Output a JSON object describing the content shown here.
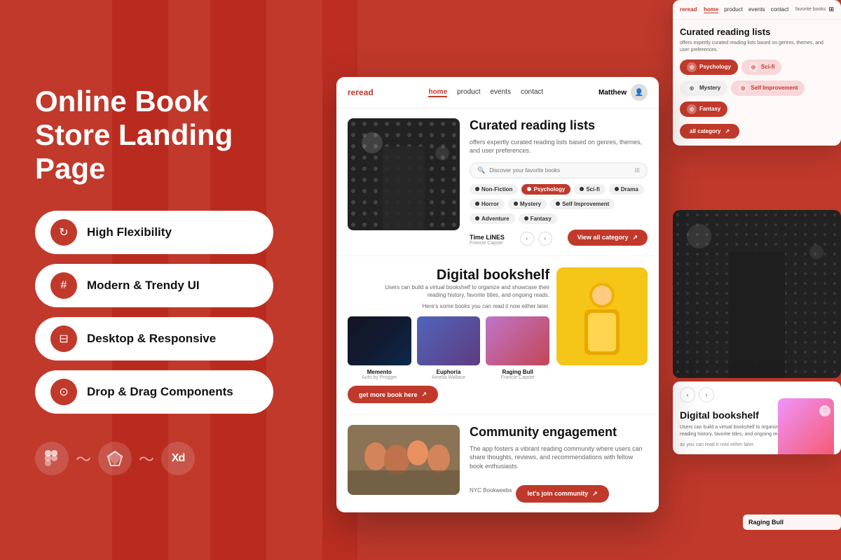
{
  "page": {
    "title": "Online Book Store Landing Page",
    "background_color": "#c0392b"
  },
  "left": {
    "title_line1": "Online Book",
    "title_line2": "Store Landing Page",
    "features": [
      {
        "id": "high-flexibility",
        "icon": "↻",
        "label": "High Flexibility"
      },
      {
        "id": "modern-trendy",
        "icon": "#",
        "label": "Modern & Trendy UI"
      },
      {
        "id": "desktop-responsive",
        "icon": "⊟",
        "label": "Desktop & Responsive"
      },
      {
        "id": "drop-drag",
        "icon": "⊙",
        "label": "Drop & Drag Components"
      }
    ],
    "tools": [
      {
        "id": "figma",
        "label": "Figma"
      },
      {
        "id": "sketch",
        "label": "Sketch"
      },
      {
        "id": "xd",
        "label": "Xd"
      }
    ]
  },
  "browser": {
    "logo": "reread",
    "nav_items": [
      {
        "id": "home",
        "label": "home",
        "active": true
      },
      {
        "id": "product",
        "label": "product",
        "active": false
      },
      {
        "id": "events",
        "label": "events",
        "active": false
      },
      {
        "id": "contact",
        "label": "contact",
        "active": false
      }
    ],
    "user_name": "Matthew",
    "sections": {
      "curated": {
        "title": "Curated reading lists",
        "description": "offers expertly curated reading lists based on genres, themes, and user preferences.",
        "search_placeholder": "Discover your favorite books",
        "tags": [
          {
            "id": "non-fiction",
            "label": "Non-Fiction",
            "active": false
          },
          {
            "id": "psychology",
            "label": "Psychology",
            "active": true
          },
          {
            "id": "sci-fi",
            "label": "Sci-fi",
            "active": false
          },
          {
            "id": "drama",
            "label": "Drama",
            "active": false
          },
          {
            "id": "horror",
            "label": "Horror",
            "active": false
          },
          {
            "id": "mystery",
            "label": "Mystery",
            "active": false
          },
          {
            "id": "self-improvement",
            "label": "Self Improvement",
            "active": false
          },
          {
            "id": "adventure",
            "label": "Adventure",
            "active": false
          },
          {
            "id": "fantasy",
            "label": "Fantasy",
            "active": false
          }
        ],
        "book_title": "Time LINES",
        "book_author": "Francie Capote",
        "view_all_label": "View all category"
      },
      "digital": {
        "title": "Digital bookshelf",
        "description": "Users can build a virtual bookshelf to organize and showcase their reading history, favorite titles, and ongoing reads.",
        "sub_desc": "Here's some books you can read it now either later.",
        "books": [
          {
            "id": "memento",
            "title": "Memento",
            "author": "Auto by Progger",
            "cover": "dark-blue"
          },
          {
            "id": "euphoria",
            "title": "Euphoria",
            "author": "Amelia Wallace",
            "cover": "purple"
          },
          {
            "id": "raging-bull",
            "title": "Raging Bull",
            "author": "Francie Capote",
            "cover": "pink"
          }
        ],
        "get_more_label": "get more book here"
      },
      "community": {
        "title": "Community engagement",
        "description": "The app fosters a vibrant reading community where users can share thoughts, reviews, and recommendations with fellow book enthusiasts.",
        "image_caption": "NYC Bookweebs",
        "join_label": "let's join community"
      }
    }
  },
  "right_panel": {
    "nav_items": [
      {
        "id": "home",
        "label": "home",
        "active": true
      },
      {
        "id": "product",
        "label": "product",
        "active": false
      },
      {
        "id": "events",
        "label": "events",
        "active": false
      },
      {
        "id": "contact",
        "label": "contact",
        "active": false
      }
    ],
    "favorite_books_label": "favorite books",
    "curated_title": "Curated reading lists",
    "curated_desc": "offers expertly curated reading lists based on genres, themes, and user preferences.",
    "fav_tags": [
      {
        "id": "psychology",
        "label": "Psychology",
        "style": "red"
      },
      {
        "id": "sci-fi",
        "label": "Sci-fi",
        "style": "light-red"
      },
      {
        "id": "mystery",
        "label": "Mystery",
        "style": "gray"
      },
      {
        "id": "self-improvement",
        "label": "Self Improvement",
        "style": "light-red"
      },
      {
        "id": "fantasy",
        "label": "Fantasy",
        "style": "red"
      }
    ],
    "all_category_label": "all category",
    "digital_title": "Digital bookshelf",
    "digital_desc": "Users can build a virtual bookshelf to organize and showcase their reading history, favorite titles, and ongoing reads.",
    "digital_sub": "as you can read it now either later.",
    "raging_book_label": "Raging Bull"
  }
}
